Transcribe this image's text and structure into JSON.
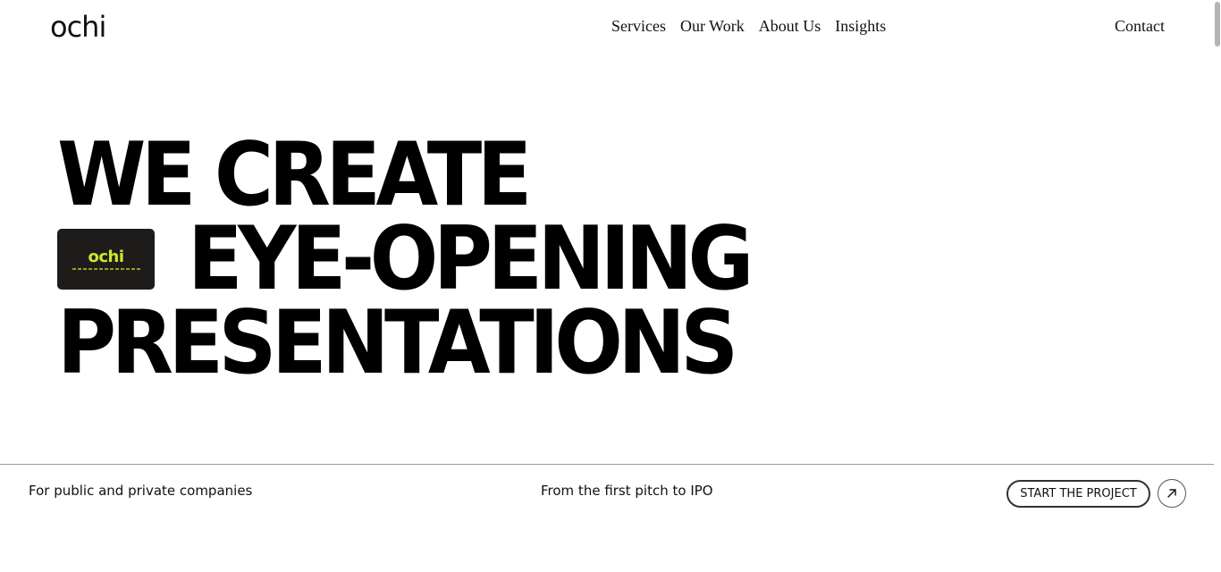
{
  "header": {
    "logo": "ochi",
    "nav": [
      "Services",
      "Our Work",
      "About Us",
      "Insights"
    ],
    "contact": "Contact"
  },
  "hero": {
    "line1": "WE CREATE",
    "line2": "EYE-OPENING",
    "line3": "PRESENTATIONS",
    "thumbnail_brand": "ochi"
  },
  "strip": {
    "left_text": "For public and private companies",
    "center_text": "From the first pitch to IPO",
    "cta_label": "START THE PROJECT",
    "cta_icon": "arrow-up-right-icon"
  },
  "colors": {
    "background": "#ffffff",
    "text": "#111111",
    "thumb_bg": "#1e1c1b",
    "thumb_accent": "#cdea1f"
  }
}
